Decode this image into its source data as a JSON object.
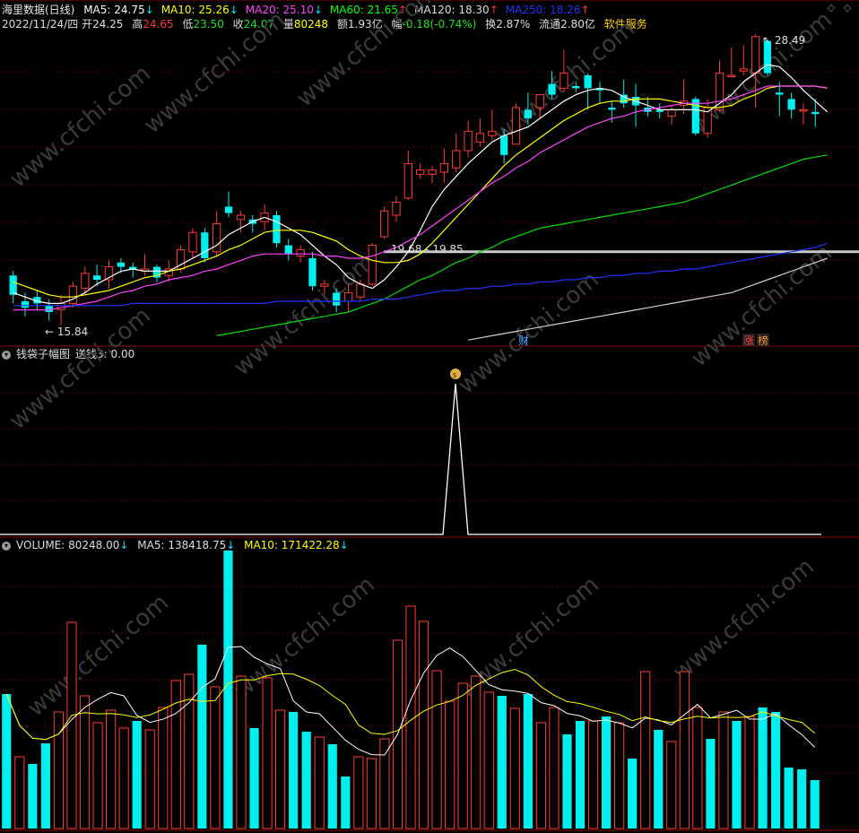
{
  "title": "海里数据(日线)",
  "ma": [
    {
      "label": "MA5: 24.75",
      "arrow": "↓",
      "color": "#ffffff",
      "arrowColor": "#00e5ff"
    },
    {
      "label": "MA10: 25.26",
      "arrow": "↓",
      "color": "#ffff00",
      "arrowColor": "#00e5ff"
    },
    {
      "label": "MA20: 25.10",
      "arrow": "↓",
      "color": "#ff40ff",
      "arrowColor": "#00e5ff"
    },
    {
      "label": "MA60: 21.65",
      "arrow": "↑",
      "color": "#00ff00",
      "arrowColor": "#ff3030"
    },
    {
      "label": "MA120: 18.30",
      "arrow": "↑",
      "color": "#dddddd",
      "arrowColor": "#ff3030"
    },
    {
      "label": "MA250: 18.26",
      "arrow": "↑",
      "color": "#2030ff",
      "arrowColor": "#ff3030"
    }
  ],
  "info": {
    "date": "2022/11/24/四",
    "open_label": "开",
    "open": "24.25",
    "high_label": "高",
    "high": "24.65",
    "low_label": "低",
    "low": "23.50",
    "close_label": "收",
    "close": "24.07",
    "vol_label": "量",
    "vol": "80248",
    "amt_label": "额",
    "amt": "1.93亿",
    "chg_label": "幅",
    "chg": "-0.18(-0.74%)",
    "turn_label": "换",
    "turn": "2.87%",
    "float_label": "流通",
    "float": "2.80亿",
    "service": "软件服务"
  },
  "annotations": {
    "high_mark": "28.49",
    "low_mark": "15.84",
    "range_mark": "19.68 - 19.85",
    "badge_cai": "财",
    "badge_zhang": "涨",
    "badge_bang": "榜"
  },
  "panel2": {
    "title": "钱袋子幅图",
    "value": "送钱3: 0.00",
    "icon": "money-bag-icon"
  },
  "panel3": {
    "vol": "VOLUME: 80248.00",
    "vol_arrow": "↓",
    "ma5": "MA5: 138418.75",
    "ma5_arrow": "↓",
    "ma10": "MA10: 171422.28",
    "ma10_arrow": "↓"
  },
  "watermark": "www.cfchi.com",
  "colors": {
    "up": "#ff3b30",
    "down": "#00f0f0",
    "grid": "#5a0000"
  },
  "candles": [
    {
      "o": 20.2,
      "c": 19.3,
      "h": 20.4,
      "l": 18.9
    },
    {
      "o": 19.0,
      "c": 18.7,
      "h": 19.4,
      "l": 18.3
    },
    {
      "o": 19.2,
      "c": 18.9,
      "h": 19.5,
      "l": 18.6
    },
    {
      "o": 18.8,
      "c": 18.5,
      "h": 19.1,
      "l": 18.1
    },
    {
      "o": 18.6,
      "c": 18.9,
      "h": 19.3,
      "l": 17.9
    },
    {
      "o": 18.9,
      "c": 19.7,
      "h": 19.9,
      "l": 18.7
    },
    {
      "o": 19.6,
      "c": 20.3,
      "h": 20.6,
      "l": 19.3
    },
    {
      "o": 20.2,
      "c": 20.0,
      "h": 20.7,
      "l": 19.7
    },
    {
      "o": 20.0,
      "c": 20.6,
      "h": 20.9,
      "l": 19.6
    },
    {
      "o": 20.8,
      "c": 20.6,
      "h": 21.0,
      "l": 20.3
    },
    {
      "o": 20.6,
      "c": 20.5,
      "h": 20.8,
      "l": 20.1
    },
    {
      "o": 20.4,
      "c": 20.5,
      "h": 21.2,
      "l": 20.2
    },
    {
      "o": 20.6,
      "c": 20.1,
      "h": 20.7,
      "l": 19.9
    },
    {
      "o": 20.2,
      "c": 20.5,
      "h": 20.9,
      "l": 19.9
    },
    {
      "o": 20.5,
      "c": 21.4,
      "h": 21.6,
      "l": 20.3
    },
    {
      "o": 21.3,
      "c": 22.2,
      "h": 22.4,
      "l": 21.0
    },
    {
      "o": 22.2,
      "c": 21.0,
      "h": 22.4,
      "l": 20.8
    },
    {
      "o": 21.3,
      "c": 22.6,
      "h": 23.2,
      "l": 21.1
    },
    {
      "o": 23.4,
      "c": 23.1,
      "h": 24.1,
      "l": 22.9
    },
    {
      "o": 22.8,
      "c": 23.0,
      "h": 23.2,
      "l": 22.2
    },
    {
      "o": 22.8,
      "c": 22.6,
      "h": 23.0,
      "l": 22.2
    },
    {
      "o": 22.7,
      "c": 23.1,
      "h": 23.5,
      "l": 22.3
    },
    {
      "o": 23.0,
      "c": 21.7,
      "h": 23.2,
      "l": 21.5
    },
    {
      "o": 21.6,
      "c": 21.2,
      "h": 21.9,
      "l": 20.9
    },
    {
      "o": 21.1,
      "c": 21.4,
      "h": 21.6,
      "l": 20.8
    },
    {
      "o": 21.0,
      "c": 19.7,
      "h": 21.3,
      "l": 19.5
    },
    {
      "o": 19.7,
      "c": 19.8,
      "h": 20.0,
      "l": 19.3
    },
    {
      "o": 19.4,
      "c": 18.8,
      "h": 19.6,
      "l": 18.5
    },
    {
      "o": 19.0,
      "c": 19.4,
      "h": 19.8,
      "l": 18.5
    },
    {
      "o": 19.2,
      "c": 19.8,
      "h": 20.0,
      "l": 19.0
    },
    {
      "o": 19.8,
      "c": 21.6,
      "h": 21.7,
      "l": 19.7
    },
    {
      "o": 22.0,
      "c": 23.2,
      "h": 23.4,
      "l": 21.9
    },
    {
      "o": 23.0,
      "c": 23.6,
      "h": 23.9,
      "l": 22.7
    },
    {
      "o": 23.8,
      "c": 25.4,
      "h": 26.0,
      "l": 23.7
    },
    {
      "o": 24.9,
      "c": 25.1,
      "h": 25.4,
      "l": 24.7
    },
    {
      "o": 24.9,
      "c": 25.1,
      "h": 25.3,
      "l": 24.5
    },
    {
      "o": 25.0,
      "c": 25.4,
      "h": 26.1,
      "l": 24.5
    },
    {
      "o": 25.2,
      "c": 26.0,
      "h": 26.8,
      "l": 25.0
    },
    {
      "o": 26.0,
      "c": 26.9,
      "h": 27.4,
      "l": 25.7
    },
    {
      "o": 26.4,
      "c": 26.8,
      "h": 27.5,
      "l": 26.2
    },
    {
      "o": 26.7,
      "c": 26.9,
      "h": 27.9,
      "l": 26.5
    },
    {
      "o": 26.7,
      "c": 25.8,
      "h": 27.0,
      "l": 25.4
    },
    {
      "o": 26.3,
      "c": 28.0,
      "h": 28.2,
      "l": 26.3
    },
    {
      "o": 27.9,
      "c": 27.5,
      "h": 28.7,
      "l": 27.2
    },
    {
      "o": 28.0,
      "c": 28.6,
      "h": 28.6,
      "l": 27.5
    },
    {
      "o": 29.1,
      "c": 28.6,
      "h": 29.7,
      "l": 28.4
    },
    {
      "o": 28.9,
      "c": 29.6,
      "h": 30.7,
      "l": 28.7
    },
    {
      "o": 29.0,
      "c": 28.9,
      "h": 29.2,
      "l": 28.7
    },
    {
      "o": 29.5,
      "c": 28.9,
      "h": 29.6,
      "l": 27.9
    },
    {
      "o": 28.9,
      "c": 28.8,
      "h": 29.2,
      "l": 28.2
    },
    {
      "o": 28.0,
      "c": 27.9,
      "h": 28.3,
      "l": 27.3
    },
    {
      "o": 28.6,
      "c": 28.2,
      "h": 29.3,
      "l": 28.0
    },
    {
      "o": 28.5,
      "c": 28.1,
      "h": 29.1,
      "l": 27.1
    },
    {
      "o": 28.0,
      "c": 27.8,
      "h": 28.5,
      "l": 27.6
    },
    {
      "o": 27.9,
      "c": 27.8,
      "h": 28.2,
      "l": 27.5
    },
    {
      "o": 27.6,
      "c": 27.9,
      "h": 28.1,
      "l": 27.2
    },
    {
      "o": 28.1,
      "c": 28.3,
      "h": 29.3,
      "l": 27.7
    },
    {
      "o": 28.4,
      "c": 26.8,
      "h": 28.5,
      "l": 26.7
    },
    {
      "o": 26.8,
      "c": 28.0,
      "h": 28.4,
      "l": 26.6
    },
    {
      "o": 27.9,
      "c": 29.6,
      "h": 30.2,
      "l": 27.8
    },
    {
      "o": 29.5,
      "c": 29.5,
      "h": 30.8,
      "l": 29.4
    },
    {
      "o": 29.7,
      "c": 29.8,
      "h": 30.9,
      "l": 29.5
    },
    {
      "o": 29.6,
      "c": 31.3,
      "h": 31.4,
      "l": 28.0
    },
    {
      "o": 31.1,
      "c": 29.6,
      "h": 31.2,
      "l": 29.5
    },
    {
      "o": 28.7,
      "c": 28.6,
      "h": 29.2,
      "l": 27.6
    },
    {
      "o": 28.4,
      "c": 27.9,
      "h": 28.7,
      "l": 27.5
    },
    {
      "o": 27.9,
      "c": 27.9,
      "h": 28.2,
      "l": 27.2
    },
    {
      "o": 27.8,
      "c": 27.7,
      "h": 28.4,
      "l": 27.1
    }
  ],
  "volumes": [
    {
      "v": 150,
      "up": false
    },
    {
      "v": 80,
      "up": true
    },
    {
      "v": 72,
      "up": false
    },
    {
      "v": 95,
      "up": false
    },
    {
      "v": 130,
      "up": true
    },
    {
      "v": 230,
      "up": true
    },
    {
      "v": 148,
      "up": true
    },
    {
      "v": 118,
      "up": true
    },
    {
      "v": 132,
      "up": true
    },
    {
      "v": 112,
      "up": true
    },
    {
      "v": 120,
      "up": false
    },
    {
      "v": 110,
      "up": true
    },
    {
      "v": 135,
      "up": true
    },
    {
      "v": 165,
      "up": true
    },
    {
      "v": 172,
      "up": true
    },
    {
      "v": 205,
      "up": false
    },
    {
      "v": 158,
      "up": true
    },
    {
      "v": 310,
      "up": false
    },
    {
      "v": 170,
      "up": true
    },
    {
      "v": 112,
      "up": false
    },
    {
      "v": 168,
      "up": true
    },
    {
      "v": 132,
      "up": true
    },
    {
      "v": 130,
      "up": false
    },
    {
      "v": 108,
      "up": false
    },
    {
      "v": 102,
      "up": true
    },
    {
      "v": 94,
      "up": false
    },
    {
      "v": 58,
      "up": false
    },
    {
      "v": 80,
      "up": true
    },
    {
      "v": 78,
      "up": true
    },
    {
      "v": 100,
      "up": true
    },
    {
      "v": 210,
      "up": true
    },
    {
      "v": 248,
      "up": true
    },
    {
      "v": 231,
      "up": true
    },
    {
      "v": 176,
      "up": true
    },
    {
      "v": 142,
      "up": true
    },
    {
      "v": 162,
      "up": true
    },
    {
      "v": 170,
      "up": true
    },
    {
      "v": 152,
      "up": true
    },
    {
      "v": 148,
      "up": false
    },
    {
      "v": 134,
      "up": true
    },
    {
      "v": 150,
      "up": false
    },
    {
      "v": 118,
      "up": true
    },
    {
      "v": 135,
      "up": true
    },
    {
      "v": 105,
      "up": false
    },
    {
      "v": 120,
      "up": false
    },
    {
      "v": 120,
      "up": true
    },
    {
      "v": 125,
      "up": false
    },
    {
      "v": 118,
      "up": true
    },
    {
      "v": 78,
      "up": false
    },
    {
      "v": 175,
      "up": true
    },
    {
      "v": 110,
      "up": false
    },
    {
      "v": 97,
      "up": true
    },
    {
      "v": 175,
      "up": true
    },
    {
      "v": 135,
      "up": true
    },
    {
      "v": 100,
      "up": false
    },
    {
      "v": 130,
      "up": true
    },
    {
      "v": 120,
      "up": false
    },
    {
      "v": 125,
      "up": true
    },
    {
      "v": 135,
      "up": false
    },
    {
      "v": 130,
      "up": false
    },
    {
      "v": 68,
      "up": false
    },
    {
      "v": 66,
      "up": false
    },
    {
      "v": 54,
      "up": false
    }
  ],
  "ma_lines": {
    "ma5": [
      19.4,
      19.2,
      19.0,
      18.9,
      18.9,
      19.1,
      19.4,
      19.8,
      20.1,
      20.4,
      20.5,
      20.4,
      20.4,
      20.4,
      20.7,
      21.0,
      21.3,
      21.6,
      22.1,
      22.4,
      22.7,
      22.9,
      22.7,
      22.4,
      22.1,
      21.6,
      21.1,
      20.7,
      20.1,
      19.8,
      19.6,
      20.0,
      20.6,
      21.3,
      22.3,
      23.4,
      24.2,
      24.8,
      25.4,
      25.9,
      26.4,
      26.7,
      26.9,
      27.1,
      27.5,
      27.9,
      28.3,
      28.6,
      28.8,
      28.9,
      28.8,
      28.5,
      28.3,
      28.1,
      27.9,
      27.9,
      27.9,
      27.9,
      27.8,
      28.2,
      28.6,
      29.2,
      29.6,
      30.0,
      29.9,
      29.4,
      28.8,
      28.3,
      27.8
    ],
    "ma10": [
      19.9,
      19.7,
      19.5,
      19.3,
      19.2,
      19.2,
      19.3,
      19.4,
      19.5,
      19.7,
      19.9,
      20.1,
      20.2,
      20.4,
      20.5,
      20.7,
      20.9,
      21.1,
      21.4,
      21.6,
      21.9,
      22.2,
      22.3,
      22.3,
      22.3,
      22.2,
      22.0,
      21.8,
      21.4,
      21.1,
      20.9,
      20.8,
      20.8,
      20.9,
      21.2,
      21.7,
      22.3,
      22.9,
      23.5,
      24.1,
      24.7,
      25.3,
      25.8,
      26.2,
      26.6,
      27.0,
      27.4,
      27.7,
      28.0,
      28.2,
      28.3,
      28.3,
      28.4,
      28.4,
      28.4,
      28.3,
      28.2,
      28.1,
      28.0,
      28.0,
      28.1,
      28.4,
      28.6,
      28.9,
      29.0,
      29.0,
      29.0,
      29.0,
      28.9
    ]
  },
  "ma20_line": [
    18.6,
    18.6,
    18.6,
    18.6,
    18.7,
    18.8,
    18.9,
    19.0,
    19.2,
    19.4,
    19.5,
    19.7,
    19.8,
    20.0,
    20.1,
    20.2,
    20.4,
    20.5,
    20.7,
    20.9,
    21.1,
    21.2,
    21.2,
    21.2,
    21.2,
    21.2,
    21.1,
    21.1,
    21.0,
    21.0,
    21.1,
    21.3,
    21.5,
    21.8,
    22.1,
    22.5,
    22.9,
    23.3,
    23.7,
    24.1,
    24.5,
    24.8,
    25.2,
    25.5,
    25.9,
    26.2,
    26.5,
    26.8,
    27.1,
    27.3,
    27.5,
    27.6,
    27.8,
    27.9,
    28.0,
    28.1,
    28.2,
    28.2,
    28.2,
    28.3,
    28.4,
    28.6,
    28.8,
    29.0,
    29.0,
    29.0,
    29.0,
    29.0,
    28.9
  ],
  "ma60_line": [
    null,
    null,
    null,
    null,
    null,
    null,
    null,
    null,
    null,
    null,
    null,
    null,
    null,
    null,
    null,
    null,
    null,
    17.4,
    17.5,
    17.6,
    17.7,
    17.8,
    17.9,
    18.0,
    18.1,
    18.2,
    18.3,
    18.4,
    18.5,
    18.7,
    18.9,
    19.1,
    19.4,
    19.7,
    20.0,
    20.2,
    20.5,
    20.8,
    21.0,
    21.3,
    21.5,
    21.8,
    22.0,
    22.2,
    22.4,
    22.5,
    22.6,
    22.7,
    22.8,
    22.9,
    23.0,
    23.1,
    23.2,
    23.3,
    23.4,
    23.5,
    23.6,
    23.8,
    24.0,
    24.2,
    24.4,
    24.6,
    24.8,
    25.0,
    25.2,
    25.4,
    25.6,
    25.7,
    25.8
  ],
  "ma120_line": [
    null,
    null,
    null,
    null,
    null,
    null,
    null,
    null,
    null,
    null,
    null,
    null,
    null,
    null,
    null,
    null,
    null,
    null,
    null,
    null,
    null,
    null,
    null,
    null,
    null,
    null,
    null,
    null,
    null,
    null,
    null,
    null,
    null,
    null,
    null,
    null,
    null,
    null,
    17.2,
    17.3,
    17.4,
    17.5,
    17.6,
    17.7,
    17.8,
    17.9,
    18.0,
    18.1,
    18.2,
    18.3,
    18.4,
    18.5,
    18.6,
    18.7,
    18.8,
    18.9,
    19.0,
    19.1,
    19.2,
    19.3,
    19.4,
    19.6,
    19.8,
    20.0,
    20.2,
    20.4,
    20.6,
    20.8,
    21.0
  ],
  "ma250_line": [
    18.8,
    18.8,
    18.8,
    18.8,
    18.8,
    18.8,
    18.8,
    18.8,
    18.8,
    18.8,
    18.9,
    18.9,
    18.9,
    18.9,
    18.9,
    18.9,
    18.9,
    18.9,
    18.9,
    18.9,
    18.9,
    18.9,
    19.0,
    19.0,
    19.0,
    19.0,
    19.0,
    19.0,
    19.0,
    19.0,
    19.1,
    19.1,
    19.1,
    19.2,
    19.3,
    19.4,
    19.5,
    19.5,
    19.6,
    19.6,
    19.7,
    19.7,
    19.8,
    19.8,
    19.9,
    19.9,
    20.0,
    20.0,
    20.1,
    20.1,
    20.2,
    20.2,
    20.3,
    20.3,
    20.4,
    20.4,
    20.5,
    20.5,
    20.6,
    20.7,
    20.8,
    20.9,
    21.0,
    21.1,
    21.2,
    21.3,
    21.4,
    21.5,
    21.7
  ]
}
